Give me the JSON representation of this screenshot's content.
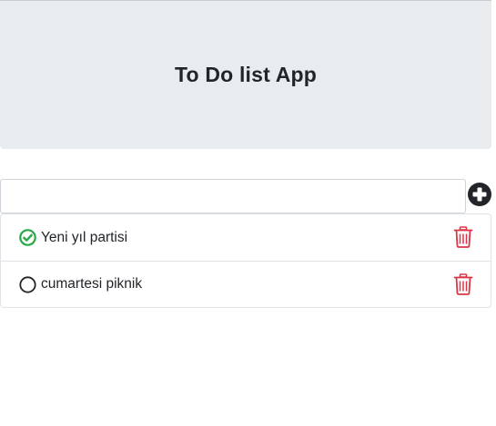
{
  "header": {
    "title": "To Do list App"
  },
  "new_todo": {
    "value": "",
    "placeholder": "",
    "add_icon": "plus-circle-icon"
  },
  "todos": [
    {
      "label": "Yeni yıl partisi",
      "completed": true,
      "status_icon": "check-circle-icon",
      "delete_icon": "trash-icon"
    },
    {
      "label": "cumartesi piknik",
      "completed": false,
      "status_icon": "empty-circle-icon",
      "delete_icon": "trash-icon"
    }
  ],
  "colors": {
    "header_background": "#e9ecef",
    "completed_green": "#28a745",
    "delete_red": "#dc3545",
    "add_button": "#212529"
  }
}
